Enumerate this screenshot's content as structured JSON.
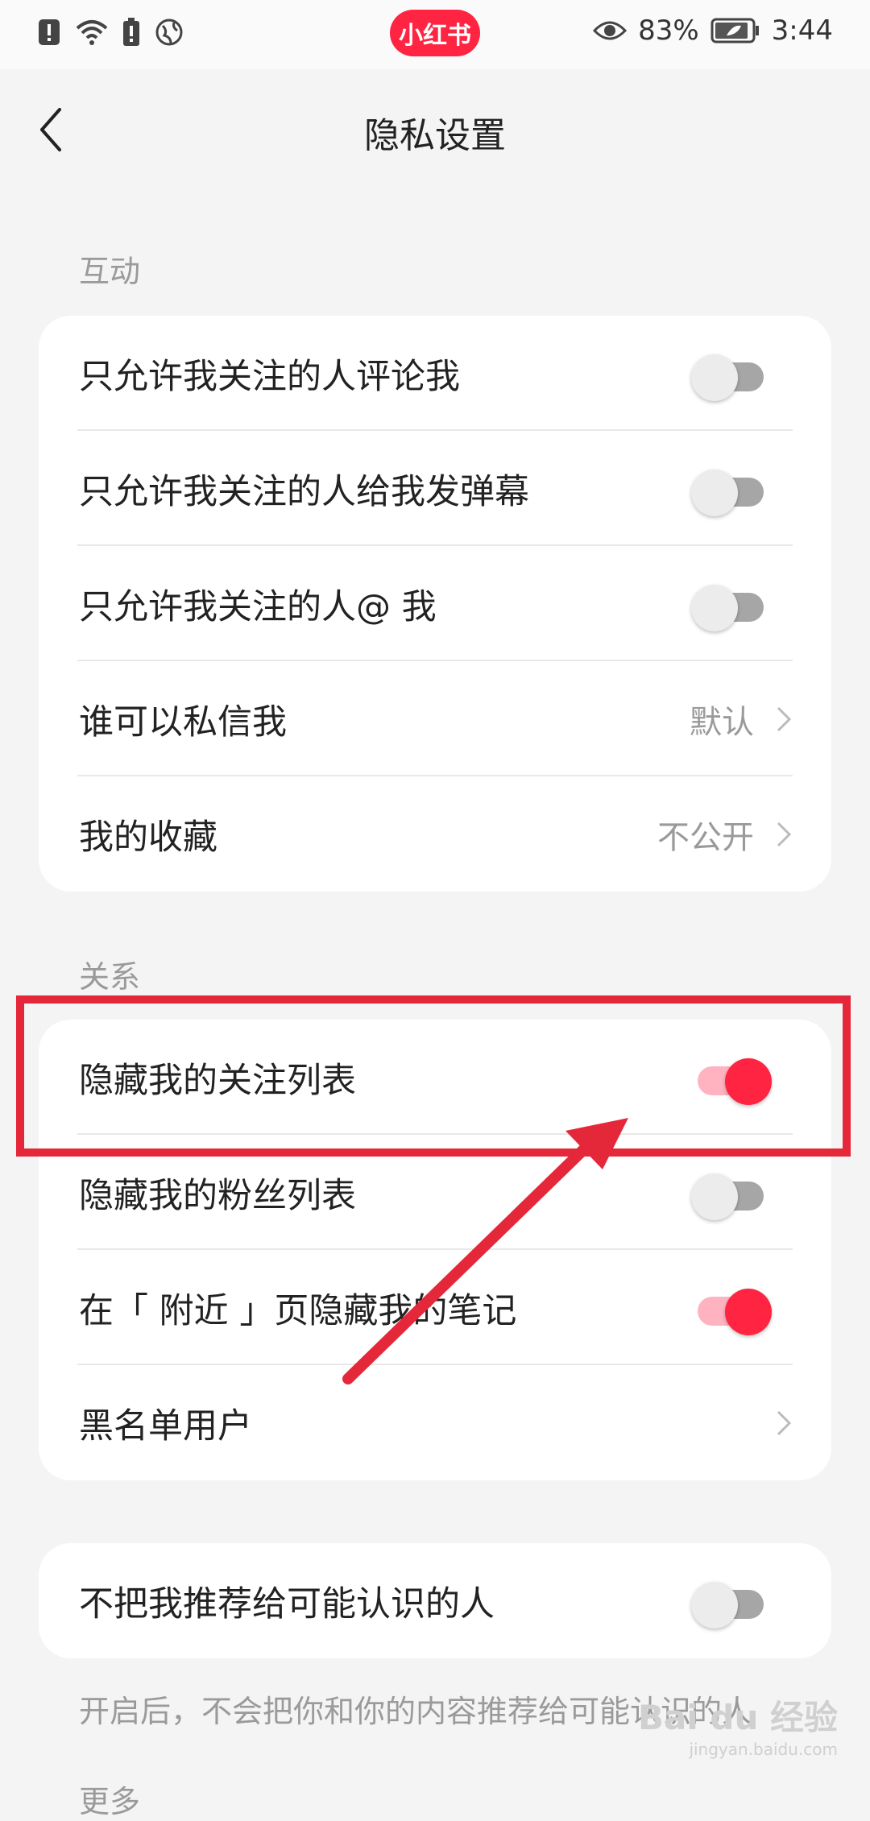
{
  "status_bar": {
    "app_name": "小红书",
    "battery_percent": "83%",
    "time": "3:44"
  },
  "header": {
    "title": "隐私设置"
  },
  "sections": {
    "interaction": {
      "label": "互动",
      "rows": [
        {
          "label": "只允许我关注的人评论我",
          "toggle": false
        },
        {
          "label": "只允许我关注的人给我发弹幕",
          "toggle": false
        },
        {
          "label": "只允许我关注的人@ 我",
          "toggle": false
        },
        {
          "label": "谁可以私信我",
          "value": "默认"
        },
        {
          "label": "我的收藏",
          "value": "不公开"
        }
      ]
    },
    "relations": {
      "label": "关系",
      "rows": [
        {
          "label": "隐藏我的关注列表",
          "toggle": true
        },
        {
          "label": "隐藏我的粉丝列表",
          "toggle": false
        },
        {
          "label": "在「 附近 」页隐藏我的笔记",
          "toggle": true
        },
        {
          "label": "黑名单用户"
        }
      ]
    },
    "recommend": {
      "rows": [
        {
          "label": "不把我推荐给可能认识的人",
          "toggle": false
        }
      ],
      "hint": "开启后，不会把你和你的内容推荐给可能认识的人"
    },
    "more": {
      "label": "更多"
    }
  },
  "watermark": {
    "brand": "Bai du 经验",
    "url": "jingyan.baidu.com"
  },
  "colors": {
    "accent": "#ff2442",
    "annotation": "#e5273a"
  }
}
